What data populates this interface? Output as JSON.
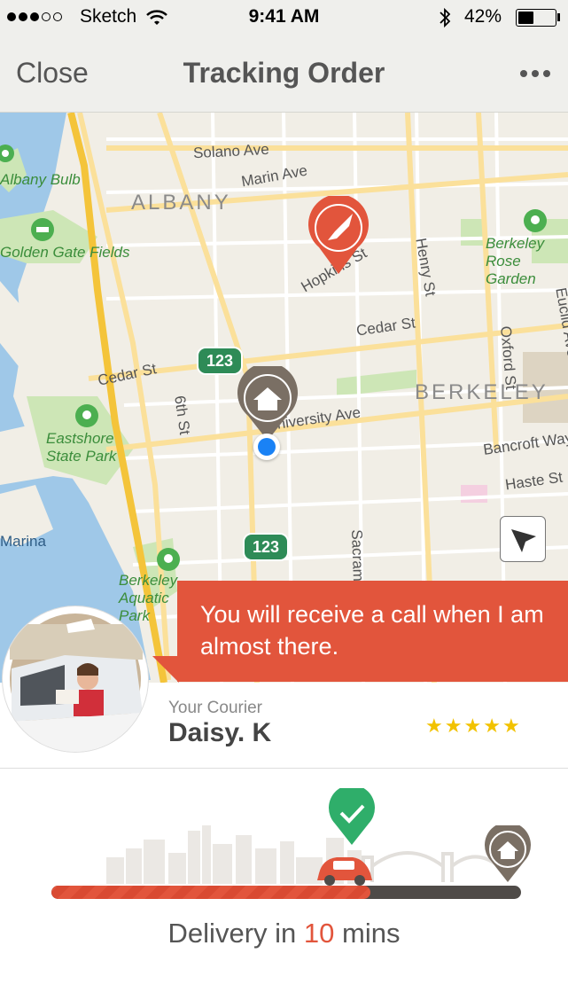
{
  "status_bar": {
    "carrier": "Sketch",
    "time": "9:41 AM",
    "battery": "42%",
    "battery_level": 0.42
  },
  "navbar": {
    "close_label": "Close",
    "title": "Tracking Order"
  },
  "map": {
    "streets": [
      "Solano Ave",
      "Marin Ave",
      "Hopkins St",
      "Cedar St",
      "Cedar St",
      "Henry St",
      "Oxford St",
      "Euclid Ave",
      "6th St",
      "University Ave",
      "Bancroft Way",
      "Haste St",
      "Sacramento St"
    ],
    "places": [
      "ALBANY",
      "BERKELEY"
    ],
    "parks": [
      "Albany Bulb",
      "Golden Gate Fields",
      "Eastshore State Park",
      "Berkeley Rose Garden",
      "Berkeley Aquatic Park",
      "Marina"
    ],
    "highway_shield": "123"
  },
  "callout": {
    "message": "You will receive a call when I am almost there."
  },
  "courier": {
    "caption": "Your Courier",
    "name": "Daisy. K",
    "rating": 5
  },
  "delivery": {
    "prefix": "Delivery in",
    "minutes": "10",
    "suffix": "mins",
    "progress": 0.68
  },
  "colors": {
    "accent": "#e2553c",
    "check_green": "#2fae6a",
    "star": "#f2c200",
    "marker_brown": "#7a6f64"
  }
}
